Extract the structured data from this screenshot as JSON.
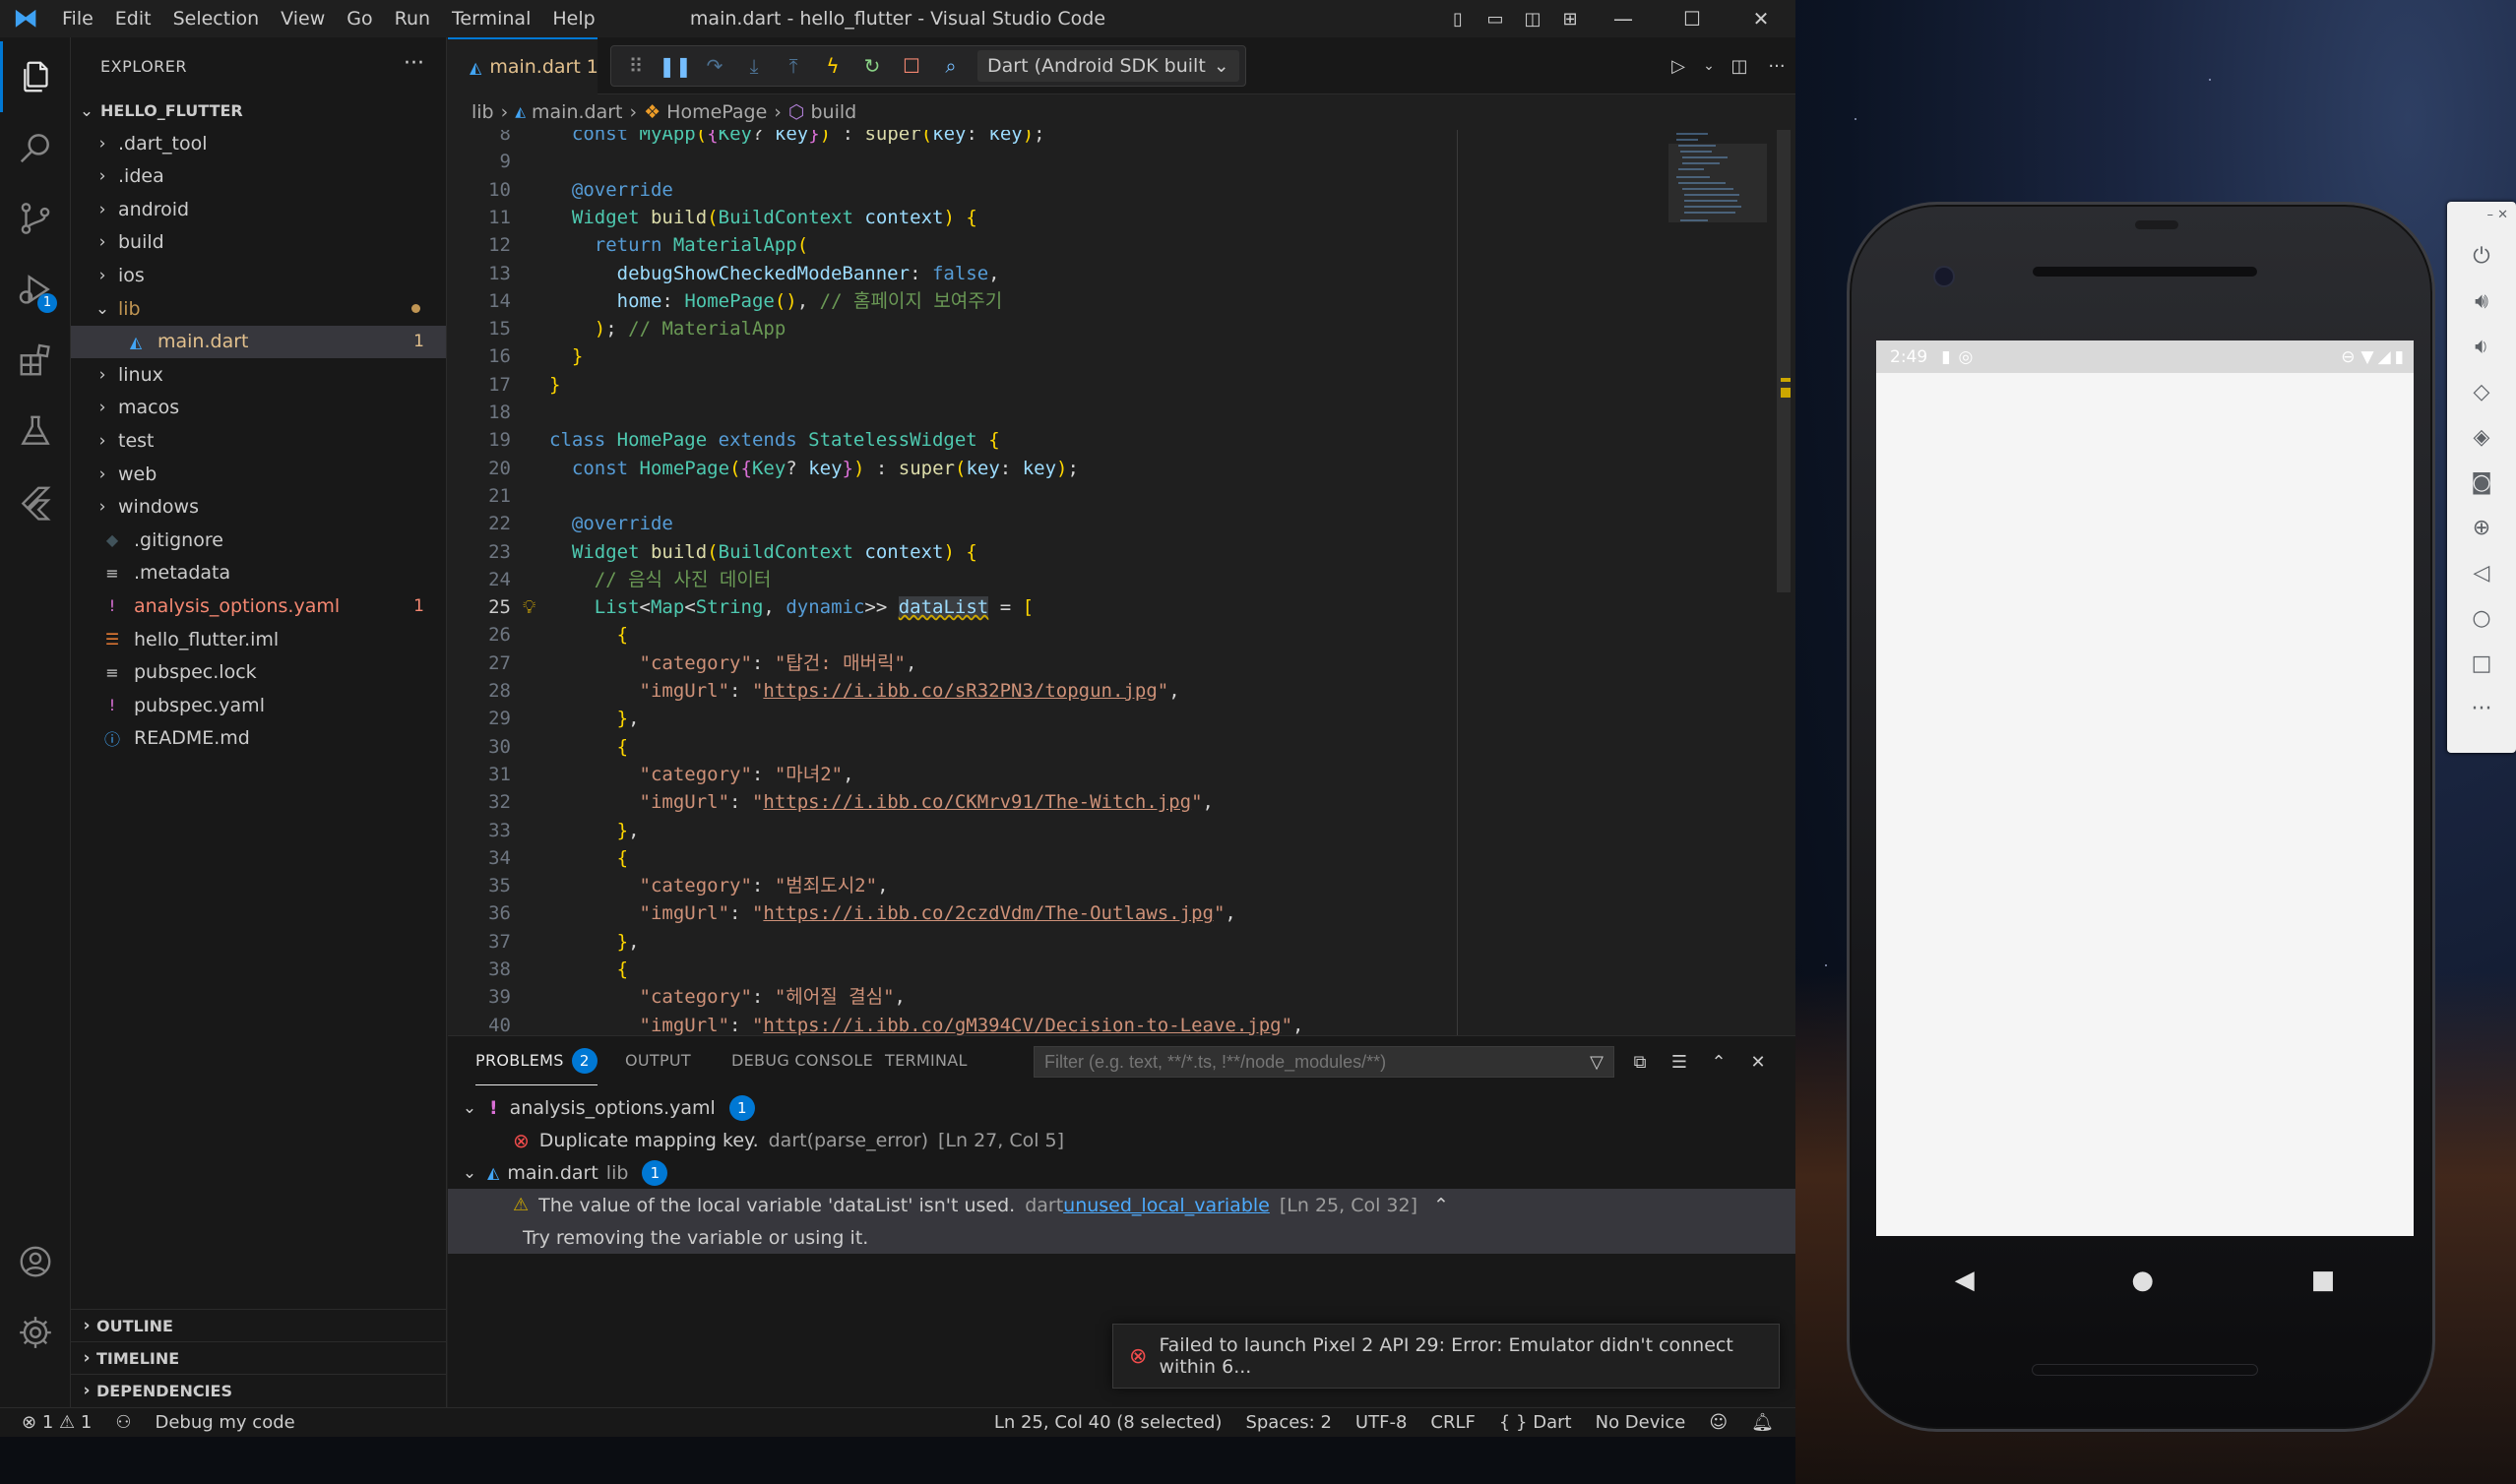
{
  "window": {
    "title": "main.dart - hello_flutter - Visual Studio Code",
    "menu": [
      "File",
      "Edit",
      "Selection",
      "View",
      "Go",
      "Run",
      "Terminal",
      "Help"
    ]
  },
  "activity_bar": {
    "items": [
      "explorer-icon",
      "search-icon",
      "source-control-icon",
      "run-debug-icon",
      "extensions-icon",
      "testing-icon",
      "flutter-icon"
    ],
    "run_badge": "1"
  },
  "explorer": {
    "header": "EXPLORER",
    "more": "···",
    "root": "HELLO_FLUTTER",
    "items": [
      {
        "label": ".dart_tool",
        "type": "folder"
      },
      {
        "label": ".idea",
        "type": "folder"
      },
      {
        "label": "android",
        "type": "folder"
      },
      {
        "label": "build",
        "type": "folder"
      },
      {
        "label": "ios",
        "type": "folder"
      },
      {
        "label": "lib",
        "type": "folder-open"
      },
      {
        "label": "main.dart",
        "type": "dart",
        "count": "1"
      },
      {
        "label": "linux",
        "type": "folder"
      },
      {
        "label": "macos",
        "type": "folder"
      },
      {
        "label": "test",
        "type": "folder"
      },
      {
        "label": "web",
        "type": "folder"
      },
      {
        "label": "windows",
        "type": "folder"
      },
      {
        "label": ".gitignore",
        "type": "git"
      },
      {
        "label": ".metadata",
        "type": "text"
      },
      {
        "label": "analysis_options.yaml",
        "type": "yaml-error",
        "count": "1"
      },
      {
        "label": "hello_flutter.iml",
        "type": "rss"
      },
      {
        "label": "pubspec.lock",
        "type": "text"
      },
      {
        "label": "pubspec.yaml",
        "type": "yaml"
      },
      {
        "label": "README.md",
        "type": "info"
      }
    ],
    "sections": [
      "OUTLINE",
      "TIMELINE",
      "DEPENDENCIES"
    ]
  },
  "editor": {
    "tab": {
      "label": "main.dart",
      "count": "1"
    },
    "debug_target": "Dart (Android SDK built",
    "breadcrumb": [
      "lib",
      "main.dart",
      "HomePage",
      "build"
    ],
    "current_line": "25",
    "lines": [
      {
        "n": "8",
        "t": "  const MyApp({Key? key}) : super(key: key);"
      },
      {
        "n": "9",
        "t": ""
      },
      {
        "n": "10",
        "t": "  @override"
      },
      {
        "n": "11",
        "t": "  Widget build(BuildContext context) {"
      },
      {
        "n": "12",
        "t": "    return MaterialApp("
      },
      {
        "n": "13",
        "t": "      debugShowCheckedModeBanner: false,"
      },
      {
        "n": "14",
        "t": "      home: HomePage(), // 홈페이지 보여주기"
      },
      {
        "n": "15",
        "t": "    ); // MaterialApp"
      },
      {
        "n": "16",
        "t": "  }"
      },
      {
        "n": "17",
        "t": "}"
      },
      {
        "n": "18",
        "t": ""
      },
      {
        "n": "19",
        "t": "class HomePage extends StatelessWidget {"
      },
      {
        "n": "20",
        "t": "  const HomePage({Key? key}) : super(key: key);"
      },
      {
        "n": "21",
        "t": ""
      },
      {
        "n": "22",
        "t": "  @override"
      },
      {
        "n": "23",
        "t": "  Widget build(BuildContext context) {"
      },
      {
        "n": "24",
        "t": "    // 음식 사진 데이터"
      },
      {
        "n": "25",
        "t": "    List<Map<String, dynamic>> dataList = ["
      },
      {
        "n": "26",
        "t": "      {"
      },
      {
        "n": "27",
        "t": "        \"category\": \"탑건: 매버릭\","
      },
      {
        "n": "28",
        "t": "        \"imgUrl\": \"https://i.ibb.co/sR32PN3/topgun.jpg\","
      },
      {
        "n": "29",
        "t": "      },"
      },
      {
        "n": "30",
        "t": "      {"
      },
      {
        "n": "31",
        "t": "        \"category\": \"마녀2\","
      },
      {
        "n": "32",
        "t": "        \"imgUrl\": \"https://i.ibb.co/CKMrv91/The-Witch.jpg\","
      },
      {
        "n": "33",
        "t": "      },"
      },
      {
        "n": "34",
        "t": "      {"
      },
      {
        "n": "35",
        "t": "        \"category\": \"범죄도시2\","
      },
      {
        "n": "36",
        "t": "        \"imgUrl\": \"https://i.ibb.co/2czdVdm/The-Outlaws.jpg\","
      },
      {
        "n": "37",
        "t": "      },"
      },
      {
        "n": "38",
        "t": "      {"
      },
      {
        "n": "39",
        "t": "        \"category\": \"헤어질 결심\","
      },
      {
        "n": "40",
        "t": "        \"imgUrl\": \"https://i.ibb.co/gM394CV/Decision-to-Leave.jpg\","
      }
    ]
  },
  "panel": {
    "tabs": [
      "PROBLEMS",
      "OUTPUT",
      "DEBUG CONSOLE",
      "TERMINAL"
    ],
    "problems_count": "2",
    "filter_placeholder": "Filter (e.g. text, **/*.ts, !**/node_modules/**)",
    "groups": [
      {
        "file": "analysis_options.yaml",
        "dir": "",
        "count": "1",
        "message": "Duplicate mapping key.",
        "source": "dart(parse_error)",
        "location": "[Ln 27, Col 5]"
      },
      {
        "file": "main.dart",
        "dir": "lib",
        "count": "1",
        "message": "The value of the local variable 'dataList' isn't used.",
        "source": "dart",
        "code": "unused_local_variable",
        "location": "[Ln 25, Col 32]",
        "hint": "Try removing the variable or using it."
      }
    ]
  },
  "toast": {
    "message": "Failed to launch Pixel 2 API 29: Error: Emulator didn't connect within 6..."
  },
  "statusbar": {
    "errors": "1",
    "warnings": "1",
    "debug": "Debug my code",
    "position": "Ln 25, Col 40 (8 selected)",
    "spaces": "Spaces: 2",
    "encoding": "UTF-8",
    "eol": "CRLF",
    "language": "Dart",
    "device": "No Device"
  },
  "emulator": {
    "time": "2:49"
  },
  "colors": {
    "accent": "#0078d4",
    "error": "#f14c4c",
    "warning": "#cca700",
    "modified": "#e2c08d"
  }
}
